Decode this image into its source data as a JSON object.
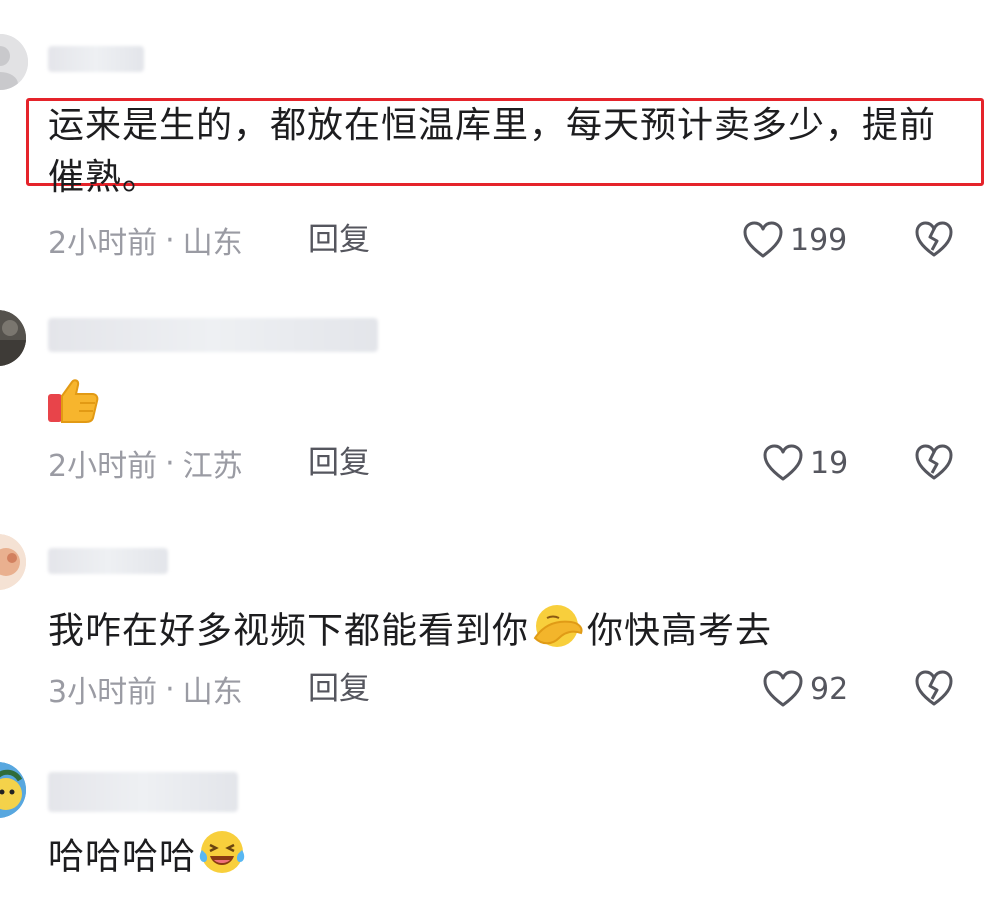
{
  "comments": [
    {
      "text": "运来是生的，都放在恒温库里，每天预计卖多少，提前催熟。",
      "time": "2小时前",
      "location": "山东",
      "reply_label": "回复",
      "likes": "199"
    },
    {
      "text": "",
      "emoji": "thumbs-up-emoji",
      "time": "2小时前",
      "location": "江苏",
      "reply_label": "回复",
      "likes": "19"
    },
    {
      "text_before": "我咋在好多视频下都能看到你",
      "emoji": "facepalm-emoji",
      "text_after": "你快高考去",
      "time": "3小时前",
      "location": "山东",
      "reply_label": "回复",
      "likes": "92"
    },
    {
      "text": "哈哈哈哈",
      "emoji": "laughing-crying-emoji"
    }
  ],
  "separator": "·",
  "colors": {
    "highlight": "#e5232a",
    "meta_text": "#9a9ba3",
    "icon_stroke": "#55565e"
  }
}
